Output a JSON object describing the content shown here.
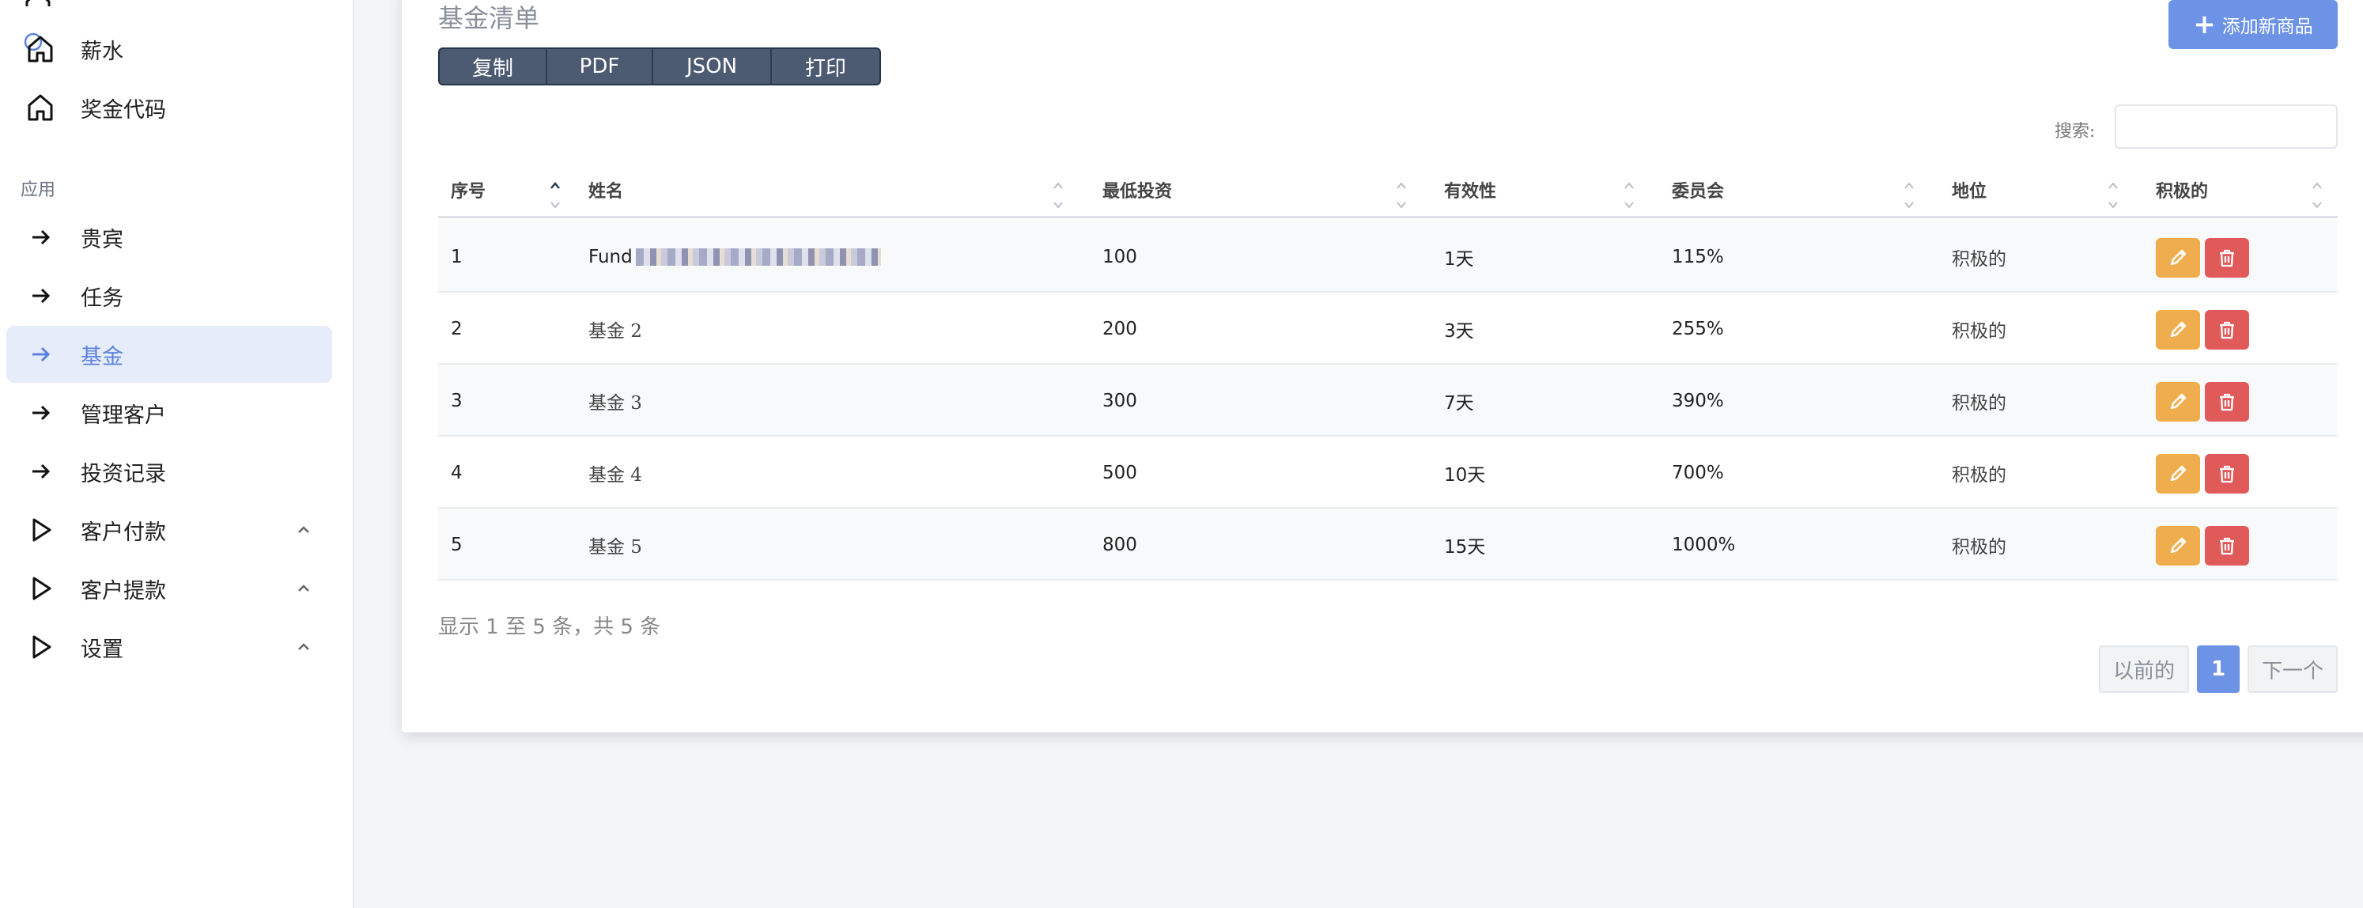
{
  "sidebar": {
    "top_items": [
      {
        "label": "薪水",
        "icon": "home-icon"
      },
      {
        "label": "奖金代码",
        "icon": "home-icon"
      }
    ],
    "section_label": "应用",
    "app_items": [
      {
        "label": "贵宾",
        "icon": "arrow-right-icon"
      },
      {
        "label": "任务",
        "icon": "arrow-right-icon"
      },
      {
        "label": "基金",
        "icon": "arrow-right-icon",
        "active": true
      },
      {
        "label": "管理客户",
        "icon": "arrow-right-icon"
      },
      {
        "label": "投资记录",
        "icon": "arrow-right-icon"
      }
    ],
    "expand_items": [
      {
        "label": "客户付款",
        "icon": "play-outline-icon"
      },
      {
        "label": "客户提款",
        "icon": "play-outline-icon"
      },
      {
        "label": "设置",
        "icon": "play-outline-icon"
      }
    ]
  },
  "card": {
    "title": "基金清单",
    "add_button": "添加新商品",
    "export_buttons": [
      "复制",
      "PDF",
      "JSON",
      "打印"
    ],
    "search_label": "搜索:",
    "search_value": ""
  },
  "table": {
    "headers": [
      "序号",
      "姓名",
      "最低投资",
      "有效性",
      "委员会",
      "地位",
      "积极的"
    ],
    "rows": [
      {
        "no": "1",
        "name": "Fund",
        "name_blurred": true,
        "min": "100",
        "validity": "1天",
        "commission": "115%",
        "status": "积极的"
      },
      {
        "no": "2",
        "name": "基金 2",
        "min": "200",
        "validity": "3天",
        "commission": "255%",
        "status": "积极的"
      },
      {
        "no": "3",
        "name": "基金 3",
        "min": "300",
        "validity": "7天",
        "commission": "390%",
        "status": "积极的"
      },
      {
        "no": "4",
        "name": "基金 4",
        "min": "500",
        "validity": "10天",
        "commission": "700%",
        "status": "积极的"
      },
      {
        "no": "5",
        "name": "基金 5",
        "min": "800",
        "validity": "15天",
        "commission": "1000%",
        "status": "积极的"
      }
    ]
  },
  "footer": {
    "info": "显示 1 至 5 条，共 5 条",
    "prev": "以前的",
    "current_page": "1",
    "next": "下一个"
  },
  "colors": {
    "accent": "#6d93e6",
    "active_bg": "#e6ecfa",
    "edit": "#f0ad4e",
    "delete": "#e05a5a",
    "export_bar": "#4c5a72"
  }
}
